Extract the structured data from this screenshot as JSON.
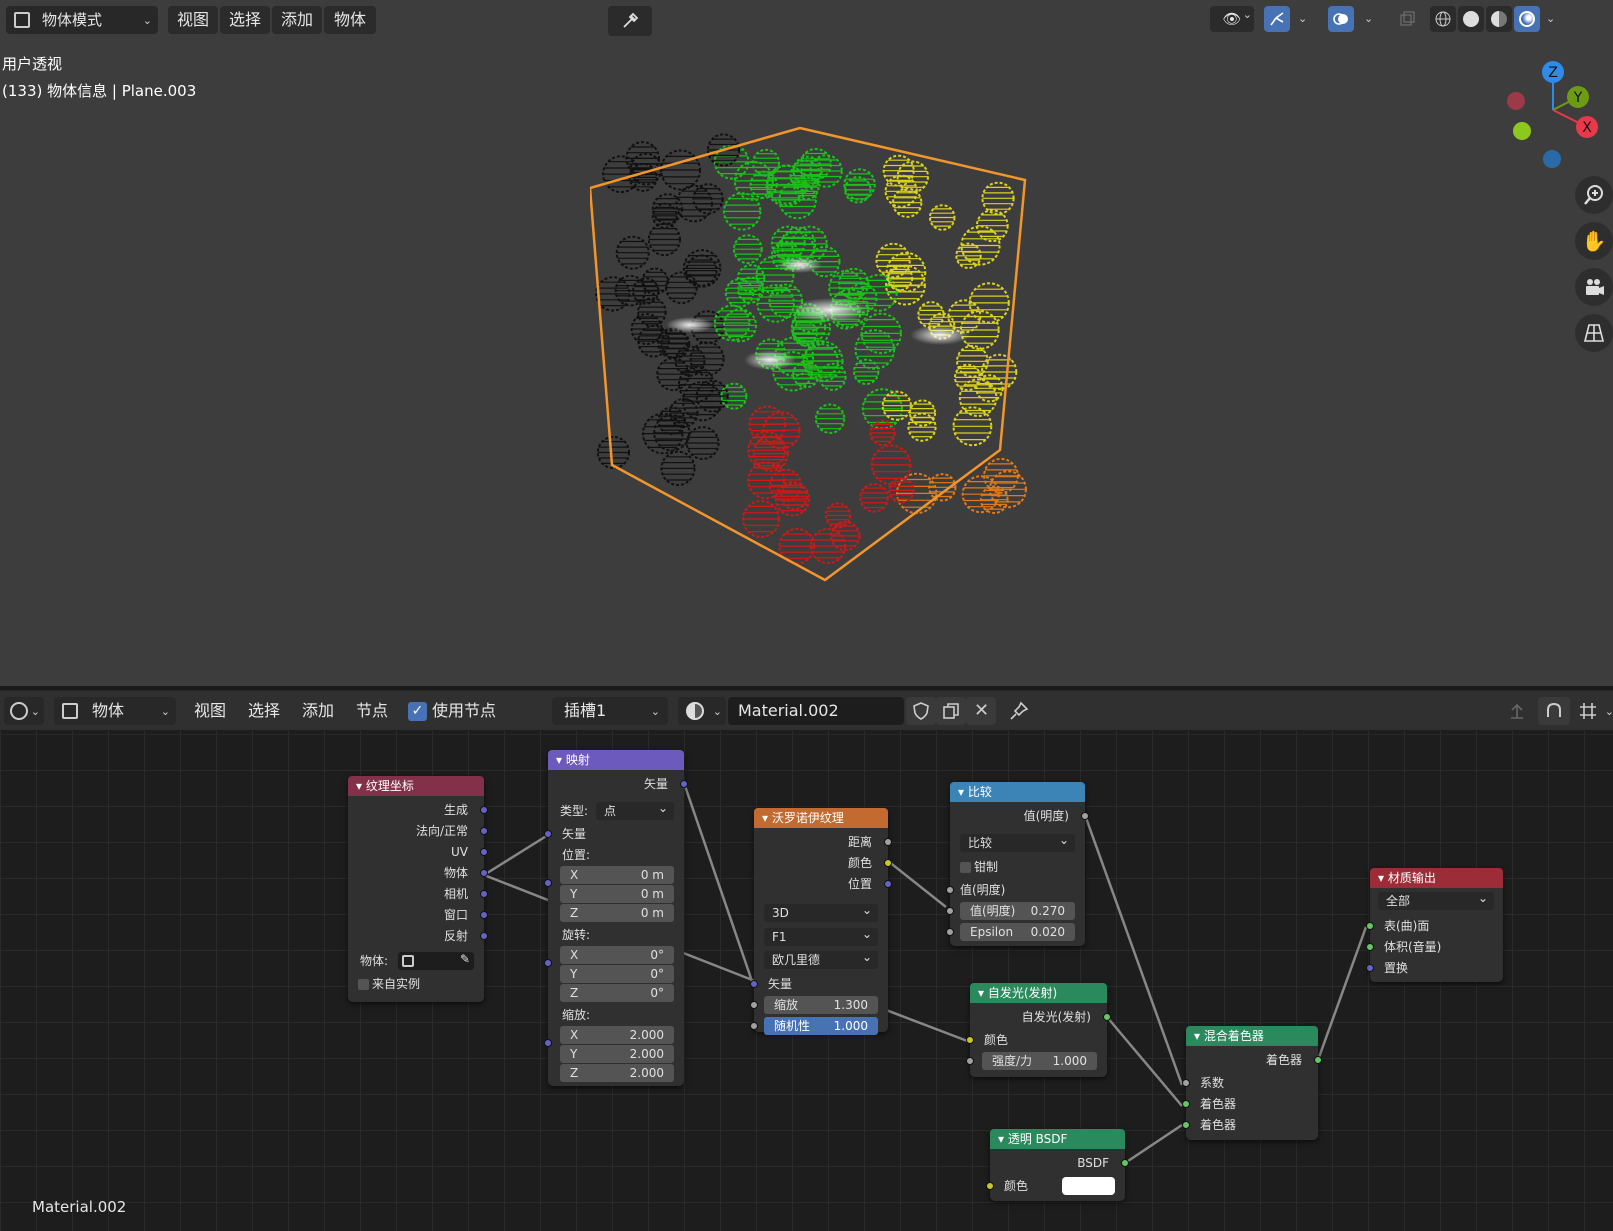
{
  "viewport": {
    "mode_dropdown": "物体模式",
    "menu": [
      "视图",
      "选择",
      "添加",
      "物体"
    ],
    "view_name": "用户透视",
    "object_info": "(133) 物体信息 | Plane.003",
    "gizmo_axes": {
      "z": "Z",
      "y": "Y",
      "x": "X"
    },
    "colors": {
      "selection_outline": "#f2962c",
      "z_axis": "#2d8ceb",
      "y_axis": "#6e9b14",
      "x_axis": "#e8384a"
    }
  },
  "node_header": {
    "editor_type_icon": "shader-editor-icon",
    "object_dropdown": "物体",
    "menu": [
      "视图",
      "选择",
      "添加",
      "节点"
    ],
    "use_nodes_label": "使用节点",
    "use_nodes_checked": true,
    "slot_dropdown": "插槽1",
    "material_name": "Material.002"
  },
  "nodes": {
    "texcoord": {
      "title": "纹理坐标",
      "outputs": [
        "生成",
        "法向/正常",
        "UV",
        "物体",
        "相机",
        "窗口",
        "反射"
      ],
      "object_label": "物体:",
      "from_instancer": "来自实例"
    },
    "mapping": {
      "title": "映射",
      "output": "矢量",
      "type_label": "类型:",
      "type_value": "点",
      "vector_label": "矢量",
      "location_label": "位置:",
      "location": [
        {
          "axis": "X",
          "value": "0 m"
        },
        {
          "axis": "Y",
          "value": "0 m"
        },
        {
          "axis": "Z",
          "value": "0 m"
        }
      ],
      "rotation_label": "旋转:",
      "rotation": [
        {
          "axis": "X",
          "value": "0°"
        },
        {
          "axis": "Y",
          "value": "0°"
        },
        {
          "axis": "Z",
          "value": "0°"
        }
      ],
      "scale_label": "缩放:",
      "scale": [
        {
          "axis": "X",
          "value": "2.000"
        },
        {
          "axis": "Y",
          "value": "2.000"
        },
        {
          "axis": "Z",
          "value": "2.000"
        }
      ]
    },
    "voronoi": {
      "title": "沃罗诺伊纹理",
      "outputs": [
        "距离",
        "颜色",
        "位置"
      ],
      "dimension": "3D",
      "feature": "F1",
      "metric": "欧几里德",
      "vector_label": "矢量",
      "scale_label": "缩放",
      "scale_value": "1.300",
      "random_label": "随机性",
      "random_value": "1.000"
    },
    "compare": {
      "title": "比较",
      "output": "值(明度)",
      "operation": "比较",
      "clamp_label": "钳制",
      "input_label": "值(明度)",
      "value_label": "值(明度)",
      "value": "0.270",
      "epsilon_label": "Epsilon",
      "epsilon": "0.020"
    },
    "emission": {
      "title": "自发光(发射)",
      "output": "自发光(发射)",
      "color_label": "颜色",
      "strength_label": "强度/力",
      "strength": "1.000"
    },
    "transparent": {
      "title": "透明 BSDF",
      "output": "BSDF",
      "color_label": "颜色",
      "color_value": "#ffffff"
    },
    "mix": {
      "title": "混合着色器",
      "output": "着色器",
      "inputs": [
        "系数",
        "着色器",
        "着色器"
      ]
    },
    "output": {
      "title": "材质输出",
      "target": "全部",
      "inputs": [
        "表(曲)面",
        "体积(音量)",
        "置换"
      ]
    }
  },
  "footer_material_label": "Material.002",
  "header_colors": {
    "input": "#83314a",
    "vector": "#6c5bbd",
    "texture": "#c26a2f",
    "converter": "#3b84b5",
    "shader": "#2b8a5d",
    "output": "#9c2d38"
  }
}
